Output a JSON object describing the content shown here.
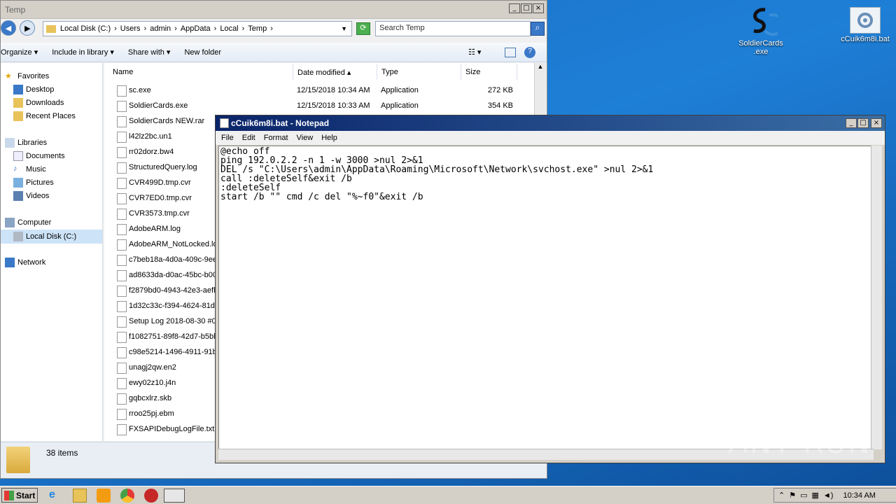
{
  "desktop": {
    "icons": [
      {
        "label": "SoldierCards .exe"
      },
      {
        "label": "cCuik6m8i.bat"
      }
    ]
  },
  "explorer": {
    "title": "Temp",
    "breadcrumb": [
      "Local Disk (C:)",
      "Users",
      "admin",
      "AppData",
      "Local",
      "Temp"
    ],
    "search_placeholder": "Search Temp",
    "toolbar": {
      "organize": "Organize",
      "include": "Include in library",
      "share": "Share with",
      "new_folder": "New folder"
    },
    "nav": {
      "favorites": "Favorites",
      "desktop": "Desktop",
      "downloads": "Downloads",
      "recent": "Recent Places",
      "libraries": "Libraries",
      "documents": "Documents",
      "music": "Music",
      "pictures": "Pictures",
      "videos": "Videos",
      "computer": "Computer",
      "local_disk": "Local Disk (C:)",
      "network": "Network"
    },
    "columns": {
      "name": "Name",
      "date": "Date modified",
      "type": "Type",
      "size": "Size"
    },
    "files": [
      {
        "name": "sc.exe",
        "date": "12/15/2018 10:34 AM",
        "type": "Application",
        "size": "272 KB"
      },
      {
        "name": "SoldierCards.exe",
        "date": "12/15/2018 10:33 AM",
        "type": "Application",
        "size": "354 KB"
      },
      {
        "name": "SoldierCards NEW.rar",
        "date": "",
        "type": "",
        "size": ""
      },
      {
        "name": "l42lz2bc.un1",
        "date": "",
        "type": "",
        "size": ""
      },
      {
        "name": "rr02dorz.bw4",
        "date": "",
        "type": "",
        "size": ""
      },
      {
        "name": "StructuredQuery.log",
        "date": "",
        "type": "",
        "size": ""
      },
      {
        "name": "CVR499D.tmp.cvr",
        "date": "",
        "type": "",
        "size": ""
      },
      {
        "name": "CVR7ED0.tmp.cvr",
        "date": "",
        "type": "",
        "size": ""
      },
      {
        "name": "CVR3573.tmp.cvr",
        "date": "",
        "type": "",
        "size": ""
      },
      {
        "name": "AdobeARM.log",
        "date": "",
        "type": "",
        "size": ""
      },
      {
        "name": "AdobeARM_NotLocked.log",
        "date": "",
        "type": "",
        "size": ""
      },
      {
        "name": "c7beb18a-4d0a-409c-9ee",
        "date": "",
        "type": "",
        "size": ""
      },
      {
        "name": "ad8633da-d0ac-45bc-b00",
        "date": "",
        "type": "",
        "size": ""
      },
      {
        "name": "f2879bd0-4943-42e3-aefl",
        "date": "",
        "type": "",
        "size": ""
      },
      {
        "name": "1d32c33c-f394-4624-81d",
        "date": "",
        "type": "",
        "size": ""
      },
      {
        "name": "Setup Log 2018-08-30 #0",
        "date": "",
        "type": "",
        "size": ""
      },
      {
        "name": "f1082751-89f8-42d7-b5bl",
        "date": "",
        "type": "",
        "size": ""
      },
      {
        "name": "c98e5214-1496-4911-91b",
        "date": "",
        "type": "",
        "size": ""
      },
      {
        "name": "unagj2qw.en2",
        "date": "",
        "type": "",
        "size": ""
      },
      {
        "name": "ewy02z10.j4n",
        "date": "",
        "type": "",
        "size": ""
      },
      {
        "name": "gqbcxlrz.skb",
        "date": "",
        "type": "",
        "size": ""
      },
      {
        "name": "rroo25pj.ebm",
        "date": "",
        "type": "",
        "size": ""
      },
      {
        "name": "FXSAPIDebugLogFile.txt",
        "date": "",
        "type": "",
        "size": ""
      }
    ],
    "status": "38 items"
  },
  "notepad": {
    "title": "cCuik6m8i.bat - Notepad",
    "menu": [
      "File",
      "Edit",
      "Format",
      "View",
      "Help"
    ],
    "content": "@echo off\nping 192.0.2.2 -n 1 -w 3000 >nul 2>&1\nDEL /s \"C:\\Users\\admin\\AppData\\Roaming\\Microsoft\\Network\\svchost.exe\" >nul 2>&1\ncall :deleteSelf&exit /b\n:deleteSelf\nstart /b \"\" cmd /c del \"%~f0\"&exit /b"
  },
  "taskbar": {
    "start": "Start",
    "clock": "10:34 AM"
  },
  "watermark": "ANY RUN"
}
